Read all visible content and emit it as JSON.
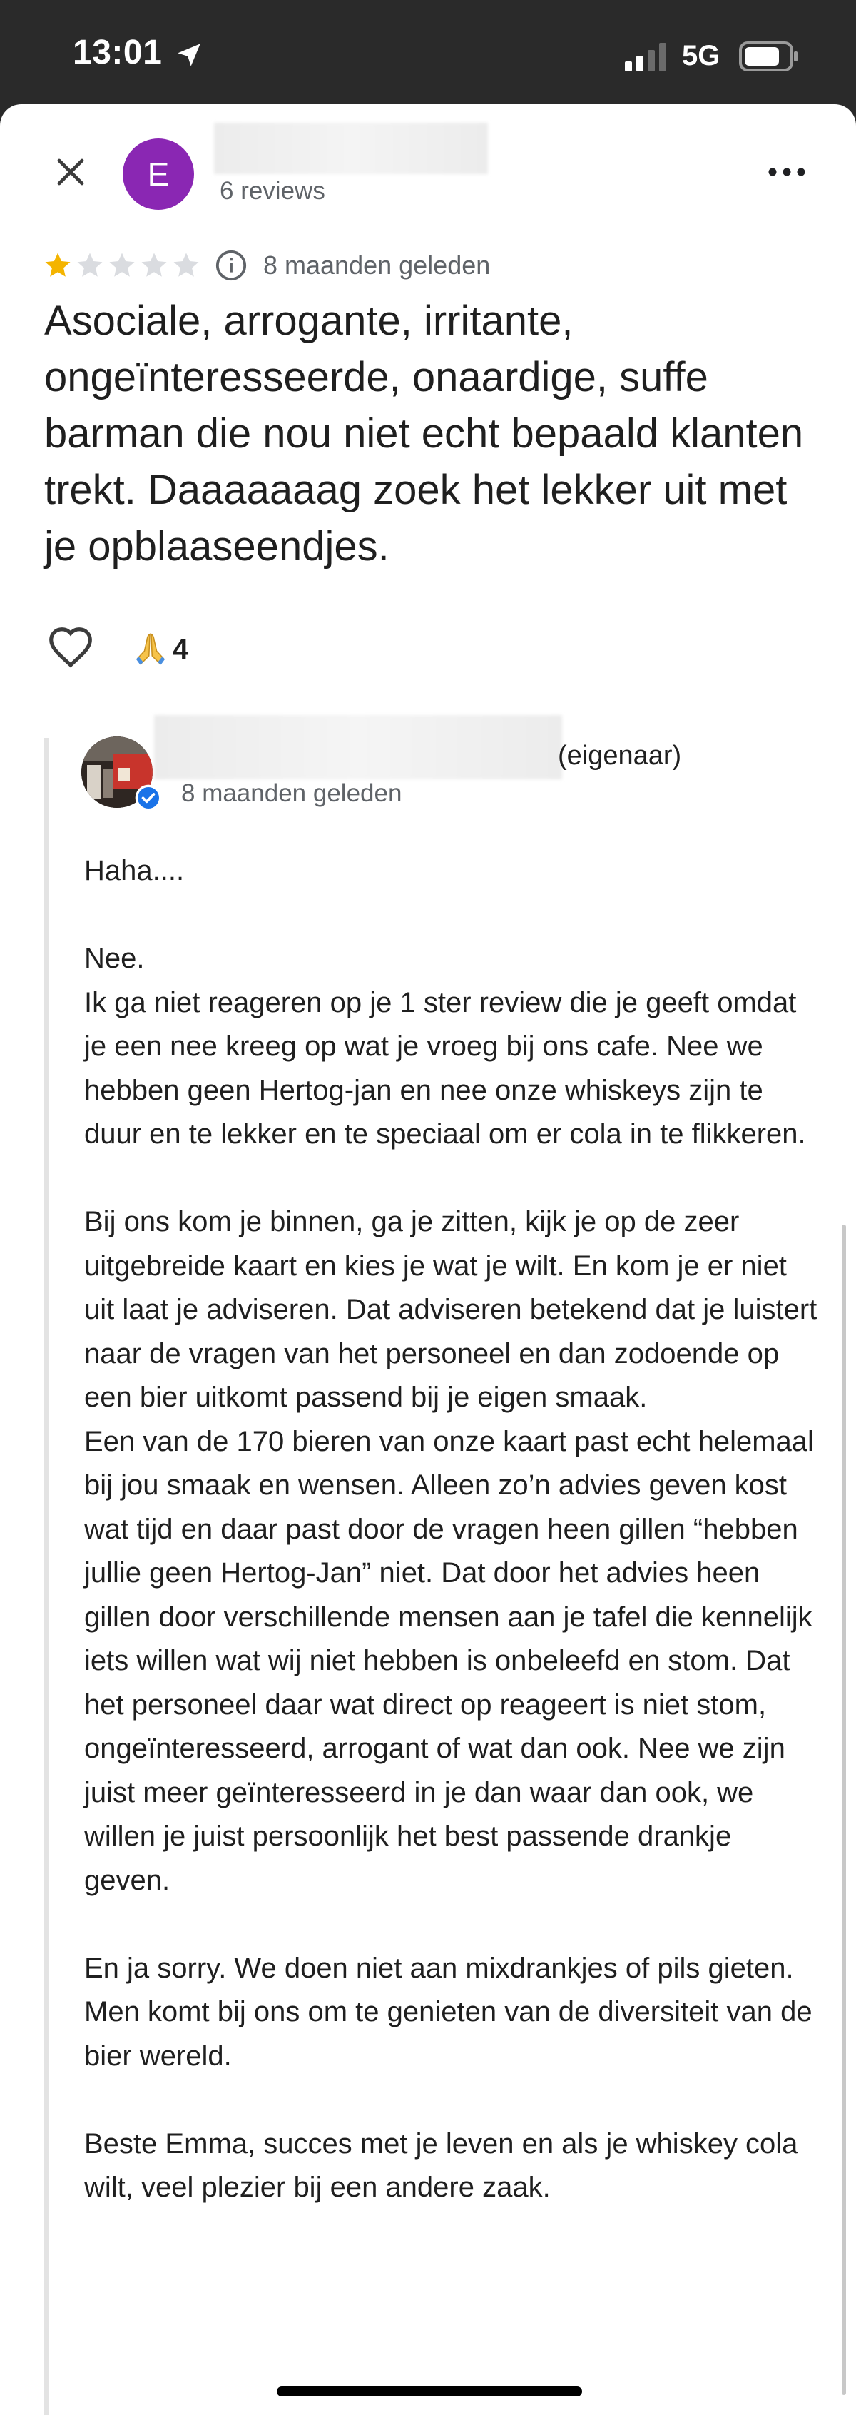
{
  "status_bar": {
    "time": "13:01",
    "network": "5G",
    "icons": [
      "location-arrow-icon",
      "signal-icon",
      "battery-icon"
    ]
  },
  "reviewer": {
    "avatar_letter": "E",
    "avatar_color": "#8a27b3",
    "review_count": "6 reviews"
  },
  "review": {
    "rating": 1,
    "max_rating": 5,
    "date": "8 maanden geleden",
    "text": "Asociale, arrogante, irritante, ongeïnteresseerde, onaardige, suffe barman die nou niet echt bepaald klanten trekt. Daaaaaaag zoek het lekker uit met je opblaaseendjes.",
    "reaction_emoji": "🙏",
    "reaction_count": "4"
  },
  "owner_reply": {
    "owner_tag": "(eigenaar)",
    "date": "8 maanden geleden",
    "paragraphs": [
      "Haha....",
      "",
      "Nee.",
      "Ik ga niet reageren op je 1 ster review die je geeft omdat je een nee kreeg op wat je vroeg bij ons cafe. Nee we hebben geen Hertog-jan en nee onze whiskeys zijn te duur en te lekker en te speciaal om er cola in te flikkeren.",
      "",
      "Bij ons kom je binnen, ga je zitten, kijk je op de zeer uitgebreide kaart en kies je wat je wilt. En kom je er niet uit laat je adviseren. Dat adviseren betekend dat je luistert naar de vragen van het personeel en dan zodoende op een bier uitkomt passend bij je eigen smaak.",
      "Een van de 170 bieren van onze kaart past echt helemaal bij jou smaak en wensen. Alleen zo’n advies geven kost wat tijd en daar past door de vragen heen gillen “hebben jullie geen Hertog-Jan” niet. Dat door het advies heen gillen door verschillende mensen aan je tafel die kennelijk iets willen wat wij niet hebben is onbeleefd en stom. Dat het personeel daar wat direct op reageert is niet stom, ongeïnteresseerd, arrogant of wat dan ook.  Nee we zijn juist meer geïnteresseerd in je dan waar dan ook, we willen je juist persoonlijk het best passende drankje geven.",
      "",
      "En ja sorry. We doen niet aan mixdrankjes of pils gieten. Men komt bij ons om te genieten van de diversiteit van de bier wereld.",
      "",
      "Beste Emma, succes met je leven en als je whiskey cola wilt, veel plezier bij een andere zaak."
    ]
  },
  "colors": {
    "star_filled": "#f4b400",
    "star_empty": "#dadce0",
    "verified": "#1a73e8"
  }
}
